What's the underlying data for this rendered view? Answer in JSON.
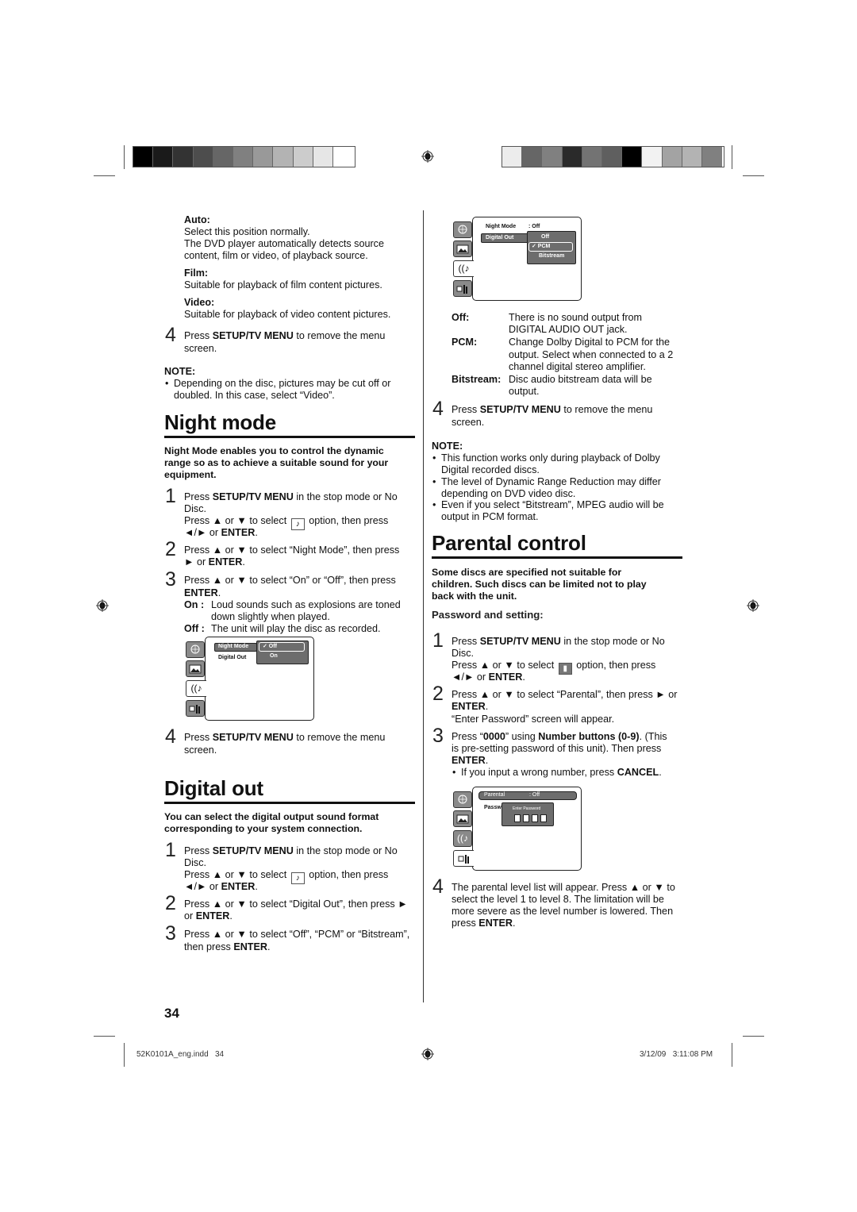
{
  "print_marks": {
    "left_color_bar": [
      "#000000",
      "#1a1a1a",
      "#333333",
      "#4d4d4d",
      "#666666",
      "#808080",
      "#999999",
      "#b3b3b3",
      "#cccccc",
      "#e6e6e6",
      "#ffffff"
    ],
    "right_color_bar": [
      "#ececec",
      "#666666",
      "#808080",
      "#2a2a2a",
      "#737373",
      "#5f5f5f",
      "#000000",
      "#f2f2f2",
      "#a3a3a3",
      "#b3b3b3",
      "#808080"
    ],
    "registration_icon": "crosshair-target-icon"
  },
  "left": {
    "options": [
      {
        "label": "Auto:",
        "text": "Select this position normally.",
        "text2": "The DVD player automatically detects source",
        "text3": "content, film or video, of playback source."
      },
      {
        "label": "Film:",
        "text": "Suitable for playback of film content pictures."
      },
      {
        "label": "Video:",
        "text": "Suitable for playback of video content pictures."
      }
    ],
    "step4_a": {
      "num": "4",
      "pre": "Press ",
      "bold": "SETUP/TV MENU",
      "post": " to remove the menu",
      "line2": "screen."
    },
    "note1": {
      "title": "NOTE:",
      "line1": "Depending on the disc, pictures may be cut off or",
      "line2": "doubled. In this case, select “Video”."
    },
    "night_mode": {
      "title": "Night mode",
      "intro": [
        "Night Mode enables you to control the dynamic",
        "range so as to achieve a suitable sound for your",
        "equipment."
      ],
      "step1": {
        "num": "1",
        "pre": "Press ",
        "bold": "SETUP/TV MENU",
        "post": " in the stop mode or No",
        "line2": "Disc.",
        "line3_pre": "Press ▲ or ▼ to select ",
        "line3_post": " option, then press",
        "line4_pre": "◄/► or ",
        "line4_bold": "ENTER",
        "line4_post": "."
      },
      "step2": {
        "num": "2",
        "line1": "Press ▲ or ▼ to select “Night Mode”, then press",
        "line2_pre": "► or ",
        "line2_bold": "ENTER",
        "line2_post": "."
      },
      "step3": {
        "num": "3",
        "line1": "Press ▲ or ▼ to select “On” or “Off”, then press",
        "line2_bold": "ENTER",
        "line2_post": ".",
        "on_label": "On :",
        "on_text": "Loud sounds such as explosions are toned",
        "on_text2": "down slightly when played.",
        "off_label": "Off :",
        "off_text": "The unit will play the disc as recorded."
      },
      "menu": {
        "item1": "Night Mode",
        "item2": "Digital Out",
        "options": [
          "✓ Off",
          "On"
        ],
        "selected": "Off"
      },
      "step4": {
        "num": "4",
        "pre": "Press ",
        "bold": "SETUP/TV MENU",
        "post": " to remove the menu",
        "line2": "screen."
      }
    },
    "digital_out": {
      "title": "Digital out",
      "intro": [
        "You can select the digital output sound format",
        "corresponding to your system connection."
      ],
      "step1": {
        "num": "1",
        "pre": "Press ",
        "bold": "SETUP/TV MENU",
        "post": " in the stop mode or No",
        "line2": "Disc.",
        "line3_pre": "Press ▲ or ▼ to select ",
        "line3_post": " option, then press",
        "line4_pre": "◄/► or ",
        "line4_bold": "ENTER",
        "line4_post": "."
      },
      "step2": {
        "num": "2",
        "line1": "Press ▲ or ▼ to select “Digital Out”, then press ►",
        "line2_pre": "or ",
        "line2_bold": "ENTER",
        "line2_post": "."
      },
      "step3": {
        "num": "3",
        "line1": "Press ▲ or ▼ to select “Off”, “PCM” or “Bitstream”,",
        "line2_pre": "then press ",
        "line2_bold": "ENTER",
        "line2_post": "."
      }
    },
    "page_number": "34"
  },
  "right": {
    "digital_menu": {
      "item1": "Night Mode",
      "item1_value": ": Off",
      "item2": "Digital Out",
      "options": [
        "Off",
        "✓ PCM",
        "Bitstream"
      ],
      "selected": "PCM"
    },
    "defs": [
      {
        "term": "Off:",
        "lines": [
          "There is no sound output from",
          "DIGITAL AUDIO OUT jack."
        ]
      },
      {
        "term": "PCM:",
        "lines": [
          "Change Dolby Digital to PCM for the",
          "output. Select when connected to a 2",
          "channel digital stereo amplifier."
        ]
      },
      {
        "term": "Bitstream:",
        "lines": [
          "Disc audio bitstream data will be",
          "output."
        ]
      }
    ],
    "step4": {
      "num": "4",
      "pre": "Press ",
      "bold": "SETUP/TV MENU",
      "post": " to remove the menu",
      "line2": "screen."
    },
    "note": {
      "title": "NOTE:",
      "bullets": [
        [
          "This function works only during playback of Dolby",
          "Digital recorded discs."
        ],
        [
          "The level of Dynamic Range Reduction may differ",
          "depending on DVD video disc."
        ],
        [
          "Even if you select “Bitstream”, MPEG audio will be",
          "output in PCM format."
        ]
      ]
    },
    "parental": {
      "title": "Parental control",
      "intro": [
        "Some discs are specified not suitable for",
        "children. Such discs can be limited not to play",
        "back with the unit."
      ],
      "subhead": "Password and setting:",
      "step1": {
        "num": "1",
        "pre": "Press ",
        "bold": "SETUP/TV MENU",
        "post": " in the stop mode or No",
        "line2": "Disc.",
        "line3_pre": "Press ▲ or ▼ to select ",
        "line3_post": " option, then press",
        "line4_pre": "◄/► or ",
        "line4_bold": "ENTER",
        "line4_post": "."
      },
      "step2": {
        "num": "2",
        "line1": "Press ▲ or ▼ to select “Parental”, then press ► or",
        "line2_bold": "ENTER",
        "line2_post": ".",
        "line3": "“Enter Password” screen will appear."
      },
      "step3": {
        "num": "3",
        "pre": "Press “",
        "bold1": "0000",
        "mid": "” using ",
        "bold2": "Number buttons (0-9)",
        "post": ". (This",
        "line2": "is pre-setting password of this unit). Then press",
        "line3_bold": "ENTER",
        "line3_post": ".",
        "bullet_pre": "If you input a wrong number, press ",
        "bullet_bold": "CANCEL",
        "bullet_post": "."
      },
      "menu": {
        "item1": "Parental",
        "item1_value": ": Off",
        "item2": "Passw",
        "popup_title": "Enter Password"
      },
      "step4": {
        "num": "4",
        "line1": "The parental level list will appear. Press ▲ or ▼ to",
        "line2": "select the level 1 to level 8. The limitation will be",
        "line3": "more severe as the level number is lowered. Then",
        "line4_pre": "press ",
        "line4_bold": "ENTER",
        "line4_post": "."
      }
    }
  },
  "footer": {
    "file": "52K0101A_eng.indd   34",
    "timestamp": "3/12/09   3:11:08 PM"
  }
}
